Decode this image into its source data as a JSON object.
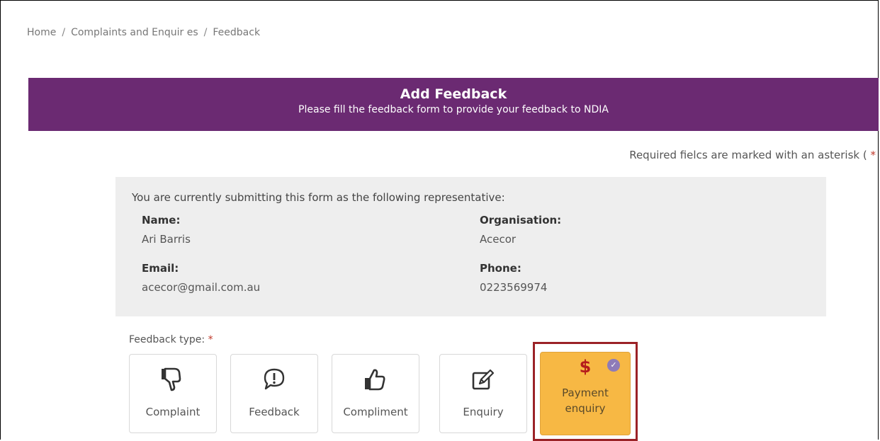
{
  "breadcrumb": {
    "items": [
      "Home",
      "Complaints and Enquir es",
      "Feedback"
    ],
    "separator": "/"
  },
  "banner": {
    "title": "Add Feedback",
    "subtitle": "Please fill the feedback form to provide your feedback to NDIA",
    "color": "#6b2a72"
  },
  "required_note": {
    "text": "Required fielcs are marked with an asterisk (",
    "star": "*"
  },
  "representative": {
    "intro": "You are currently submitting this form as the following representative:",
    "name_label": "Name:",
    "name_value": "Ari Barris",
    "org_label": "Organisation:",
    "org_value": "Acecor",
    "email_label": "Email:",
    "email_value": "acecor@gmail.com.au",
    "phone_label": "Phone:",
    "phone_value": "0223569974"
  },
  "feedback_type": {
    "label": "Feedback type:",
    "star": "*",
    "options": [
      {
        "label": "Complaint",
        "icon": "thumbs-down-icon"
      },
      {
        "label": "Feedback",
        "icon": "exclamation-bubble-icon"
      },
      {
        "label": "Compliment",
        "icon": "thumbs-up-icon"
      },
      {
        "label": "Enquiry",
        "icon": "edit-icon"
      },
      {
        "label_line1": "Payment",
        "label_line2": "enquiry",
        "icon": "dollar-icon",
        "symbol": "$",
        "check": "✓",
        "selected": true
      }
    ],
    "selected_color": "#f7b844",
    "highlight_color": "#9b2227"
  }
}
